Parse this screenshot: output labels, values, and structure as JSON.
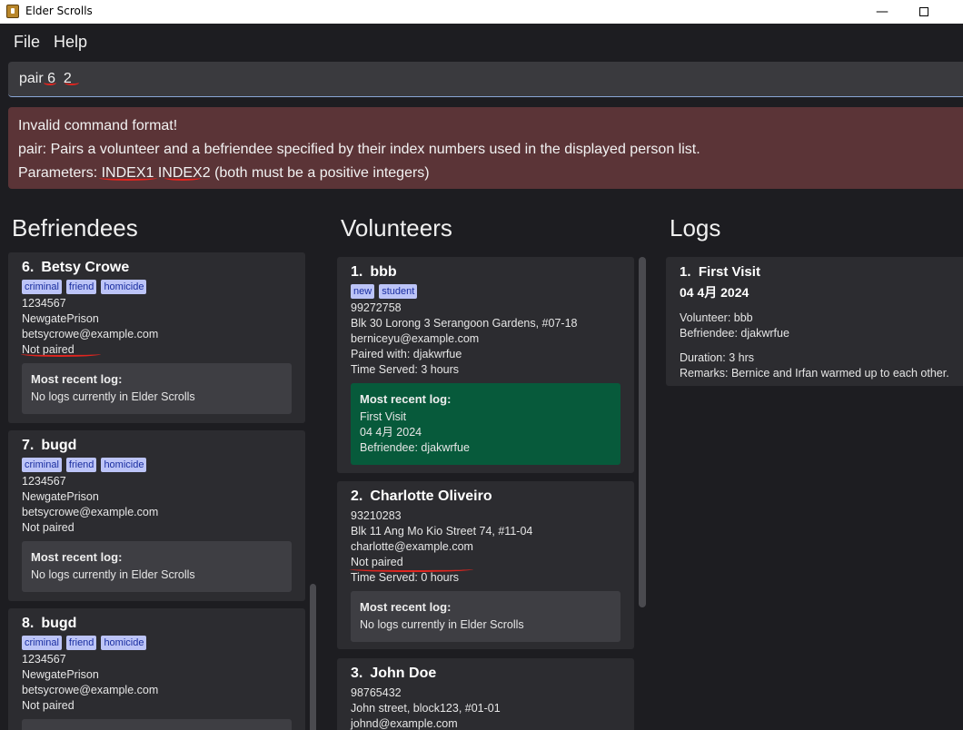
{
  "window": {
    "title": "Elder Scrolls"
  },
  "menu": {
    "file": "File",
    "help": "Help"
  },
  "command": {
    "value": "pair 6  2"
  },
  "result": {
    "lines": [
      "Invalid command format!",
      "pair: Pairs a volunteer and a befriendee specified by their index numbers used in the displayed person list.",
      "Parameters: INDEX1 INDEX2 (both must be a positive integers)"
    ]
  },
  "sections": {
    "befriendees": "Befriendees",
    "volunteers": "Volunteers",
    "logs": "Logs"
  },
  "befriendees": [
    {
      "index": "6.",
      "name": "Betsy Crowe",
      "tags": [
        "criminal",
        "friend",
        "homicide"
      ],
      "phone": "1234567",
      "address": "NewgatePrison",
      "email": "betsycrowe@example.com",
      "pair": "Not paired",
      "recent_title": "Most recent log:",
      "recent_text": "No logs currently in Elder Scrolls"
    },
    {
      "index": "7.",
      "name": "bugd",
      "tags": [
        "criminal",
        "friend",
        "homicide"
      ],
      "phone": "1234567",
      "address": "NewgatePrison",
      "email": "betsycrowe@example.com",
      "pair": "Not paired",
      "recent_title": "Most recent log:",
      "recent_text": "No logs currently in Elder Scrolls"
    },
    {
      "index": "8.",
      "name": "bugd",
      "tags": [
        "criminal",
        "friend",
        "homicide"
      ],
      "phone": "1234567",
      "address": "NewgatePrison",
      "email": "betsycrowe@example.com",
      "pair": "Not paired"
    }
  ],
  "volunteers": [
    {
      "index": "1.",
      "name": "bbb",
      "tags": [
        "new",
        "student"
      ],
      "phone": "99272758",
      "address": "Blk 30 Lorong 3 Serangoon Gardens, #07-18",
      "email": "berniceyu@example.com",
      "pair": "Paired with: djakwrfue",
      "served": "Time Served: 3 hours",
      "recent_title": "Most recent log:",
      "recent_lines": [
        "First Visit",
        "04 4月 2024",
        "Befriendee: djakwrfue"
      ]
    },
    {
      "index": "2.",
      "name": "Charlotte Oliveiro",
      "phone": "93210283",
      "address": "Blk 11 Ang Mo Kio Street 74, #11-04",
      "email": "charlotte@example.com",
      "pair": "Not paired",
      "served": "Time Served: 0 hours",
      "recent_title": "Most recent log:",
      "recent_lines": [
        "No logs currently in Elder Scrolls"
      ]
    },
    {
      "index": "3.",
      "name": "John Doe",
      "phone": "98765432",
      "address": "John street, block123, #01-01",
      "email": "johnd@example.com"
    }
  ],
  "logs": [
    {
      "index": "1.",
      "title": "First Visit",
      "date": "04 4月 2024",
      "volunteer": "Volunteer: bbb",
      "befriendee": "Befriendee: djakwrfue",
      "duration": "Duration: 3 hrs",
      "remarks": "Remarks: Bernice and Irfan warmed up to each other."
    }
  ],
  "colors": {
    "background": "#1d1d21",
    "card": "#2c2c30",
    "tag_bg": "#bcc4f7",
    "tag_text": "#1a2ea0",
    "error_bg": "#5b3437",
    "recent_green": "#075a3b",
    "annotation": "#e0251f"
  }
}
